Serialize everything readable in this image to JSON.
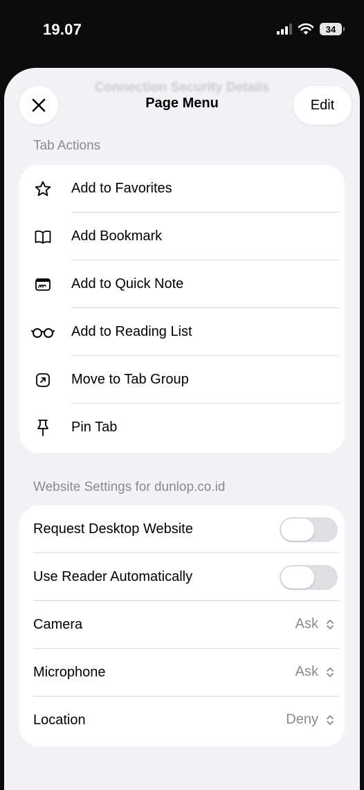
{
  "status_bar": {
    "time": "19.07",
    "battery": "34"
  },
  "sheet": {
    "background_title": "Connection Security Details",
    "title": "Page Menu",
    "edit_label": "Edit"
  },
  "tab_actions": {
    "header": "Tab Actions",
    "items": [
      {
        "label": "Add to Favorites",
        "icon": "star-icon"
      },
      {
        "label": "Add Bookmark",
        "icon": "book-icon"
      },
      {
        "label": "Add to Quick Note",
        "icon": "quick-note-icon"
      },
      {
        "label": "Add to Reading List",
        "icon": "glasses-icon"
      },
      {
        "label": "Move to Tab Group",
        "icon": "tab-group-icon"
      },
      {
        "label": "Pin Tab",
        "icon": "pin-icon"
      }
    ]
  },
  "website_settings": {
    "header": "Website Settings for dunlop.co.id",
    "toggles": [
      {
        "label": "Request Desktop Website",
        "on": false
      },
      {
        "label": "Use Reader Automatically",
        "on": false
      }
    ],
    "pickers": [
      {
        "label": "Camera",
        "value": "Ask"
      },
      {
        "label": "Microphone",
        "value": "Ask"
      },
      {
        "label": "Location",
        "value": "Deny"
      }
    ]
  },
  "colors": {
    "sheet_background": "#f2f2f7",
    "card_background": "#ffffff",
    "secondary_text": "#8a8a8e",
    "toggle_off": "#dedee3"
  }
}
